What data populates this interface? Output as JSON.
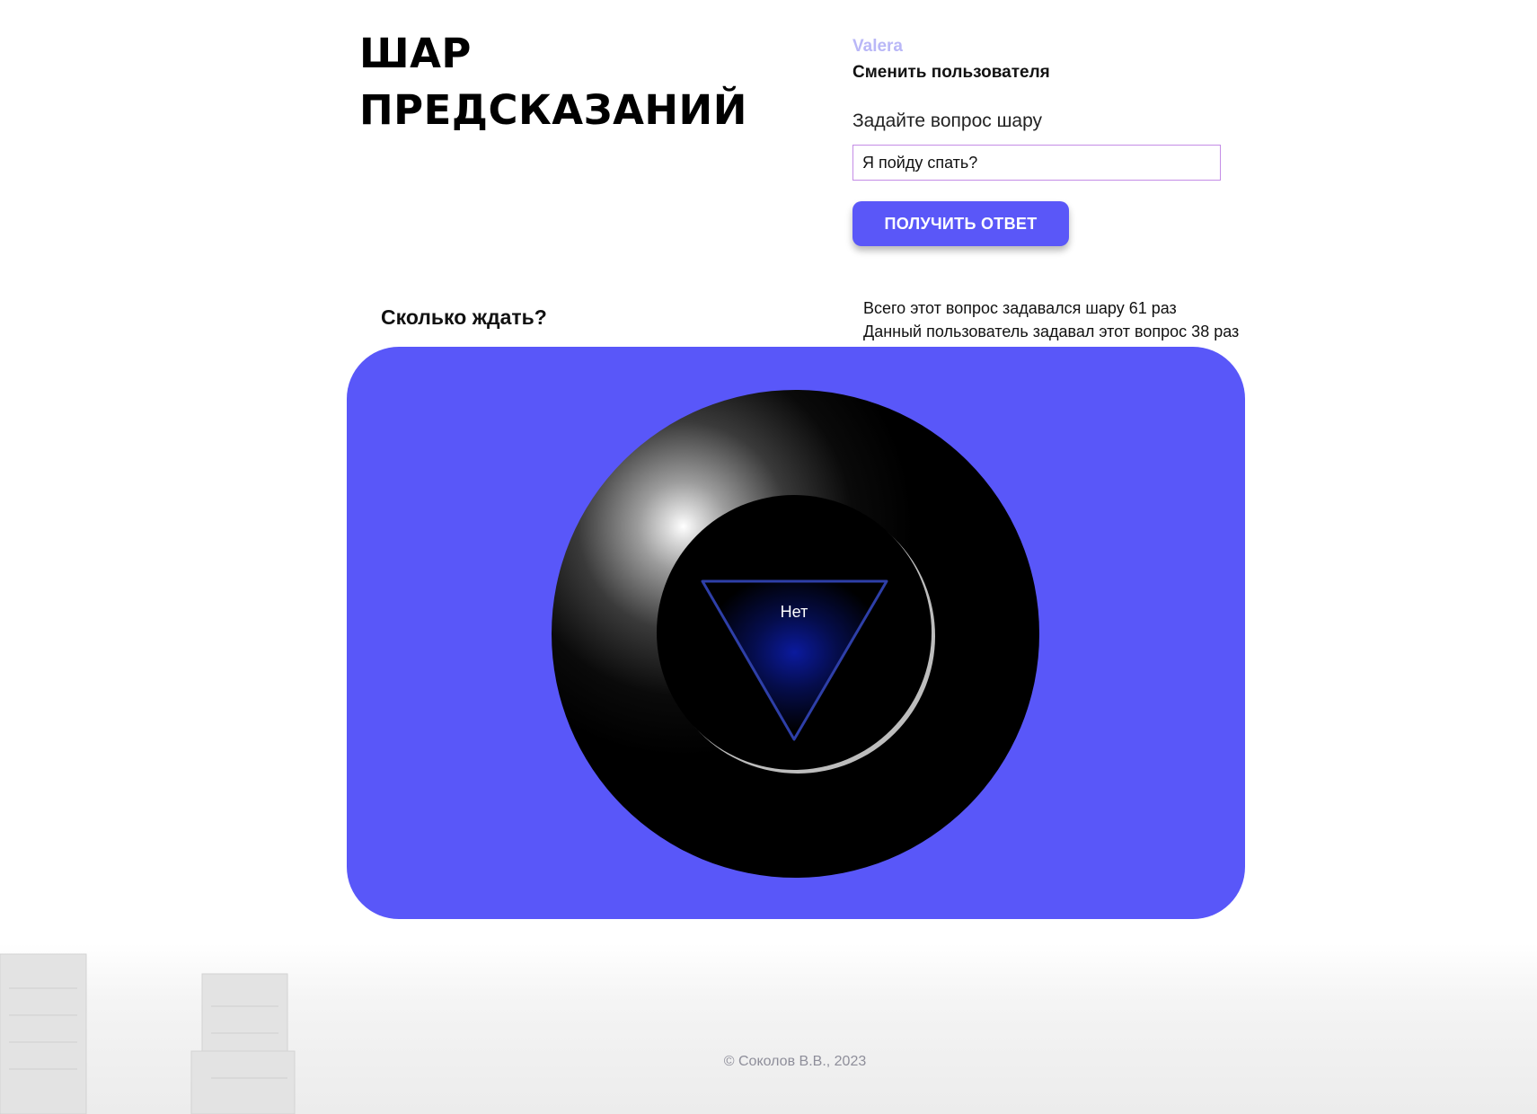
{
  "header": {
    "title_line1": "ШАР",
    "title_line2": "ПРЕДСКАЗАНИЙ"
  },
  "user": {
    "name": "Valera",
    "change_user_label": "Сменить пользователя"
  },
  "question_form": {
    "label": "Задайте вопрос шару",
    "input_value": "Я пойду спать?",
    "submit_label": "ПОЛУЧИТЬ ОТВЕТ"
  },
  "result": {
    "asked_question": "Сколько ждать?",
    "stats_total": "Всего этот вопрос задавался шару 61 раз",
    "stats_user": "Данный пользователь задавал этот вопрос 38 раз",
    "answer": "Нет"
  },
  "footer": {
    "copyright": "© Соколов В.В., 2023"
  },
  "colors": {
    "accent": "#5a57f8",
    "panel": "#5957f9",
    "username": "#b9b7f7",
    "input_border": "#c48de6",
    "triangle_stroke": "#2e3fa8"
  }
}
